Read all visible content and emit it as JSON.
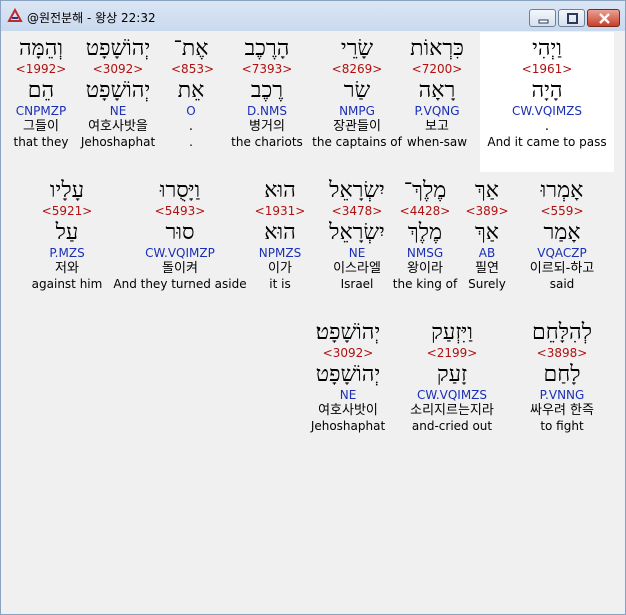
{
  "window": {
    "title": "@원전분해 - 왕상 22:32",
    "minimize_label": "",
    "maximize_label": "",
    "close_label": ""
  },
  "rows": [
    {
      "words": [
        {
          "heb": "וַיְהִי",
          "strong": "<1961>",
          "root": "הָיָה",
          "parse": "CW.VQIMZS",
          "kor": ".",
          "eng": "And it came to pass"
        },
        {
          "heb": "כִּרְאוֹת",
          "strong": "<7200>",
          "root": "רָאָה",
          "parse": "P.VQNG",
          "kor": "보고",
          "eng": "when-saw"
        },
        {
          "heb": "שָׂרֵי",
          "strong": "<8269>",
          "root": "שַׂר",
          "parse": "NMPG",
          "kor": "장관들이",
          "eng": "the captains of"
        },
        {
          "heb": "הָרֶכֶב",
          "strong": "<7393>",
          "root": "רֶכֶב",
          "parse": "D.NMS",
          "kor": "병거의",
          "eng": "the chariots"
        },
        {
          "heb": "אֶת־",
          "strong": "<853>",
          "root": "אֵת",
          "parse": "O",
          "kor": ".",
          "eng": "."
        },
        {
          "heb": "יְהוֹשָׁפָט",
          "strong": "<3092>",
          "root": "יְהוֹשָׁפָט",
          "parse": "NE",
          "kor": "여호사밧을",
          "eng": "Jehoshaphat"
        },
        {
          "heb": "וְהֵמָּה",
          "strong": "<1992>",
          "root": "הֵם",
          "parse": "CNPMZP",
          "kor": "그들이",
          "eng": "that they"
        }
      ]
    },
    {
      "words": [
        {
          "heb": "אָמְרוּ",
          "strong": "<559>",
          "root": "אָמַר",
          "parse": "VQACZP",
          "kor": "이르되-하고",
          "eng": "said"
        },
        {
          "heb": "אַךְ",
          "strong": "<389>",
          "root": "אַךְ",
          "parse": "AB",
          "kor": "필연",
          "eng": "Surely"
        },
        {
          "heb": "מֶלֶךְ־",
          "strong": "<4428>",
          "root": "מֶלֶךְ",
          "parse": "NMSG",
          "kor": "왕이라",
          "eng": "the king of"
        },
        {
          "heb": "יִשְׂרָאֵל",
          "strong": "<3478>",
          "root": "יִשְׂרָאֵל",
          "parse": "NE",
          "kor": "이스라엘",
          "eng": "Israel"
        },
        {
          "heb": "הוּא",
          "strong": "<1931>",
          "root": "הוּא",
          "parse": "NPMZS",
          "kor": "이가",
          "eng": "it is"
        },
        {
          "heb": "וַיָּסֻרוּ",
          "strong": "<5493>",
          "root": "סוּר",
          "parse": "CW.VQIMZP",
          "kor": "돌이켜",
          "eng": "And they turned aside"
        },
        {
          "heb": "עָלָיו",
          "strong": "<5921>",
          "root": "עַל",
          "parse": "P.MZS",
          "kor": "저와",
          "eng": "against him"
        }
      ]
    },
    {
      "words": [
        {
          "heb": "לְהִלָּחֵם",
          "strong": "<3898>",
          "root": "לָחַם",
          "parse": "P.VNNG",
          "kor": "싸우려 한즉",
          "eng": "to fight"
        },
        {
          "heb": "וַיִּזְעַק",
          "strong": "<2199>",
          "root": "זָעַק",
          "parse": "CW.VQIMZS",
          "kor": "소리지르는지라",
          "eng": "and-cried out"
        },
        {
          "heb": "יְהוֹשָׁפָט׃",
          "strong": "<3092>",
          "root": "יְהוֹשָׁפָט",
          "parse": "NE",
          "kor": "여호사밧이",
          "eng": "Jehoshaphat"
        }
      ]
    }
  ]
}
